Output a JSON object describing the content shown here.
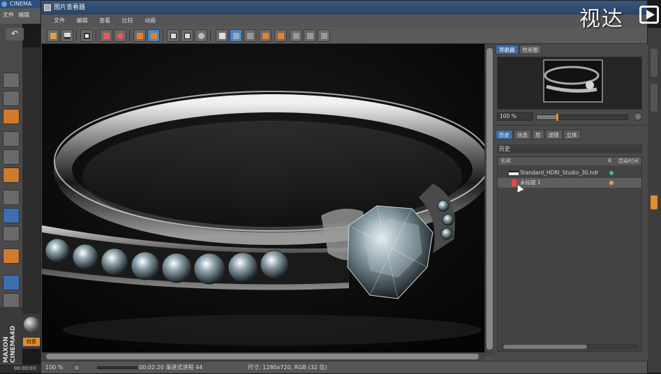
{
  "background_app": {
    "title": "CINEMA",
    "menu": [
      "文件",
      "编辑"
    ],
    "brand_logo": "MAXON CINEMA4D",
    "material_label": "材质",
    "time_readout": "00:00:03"
  },
  "viewer": {
    "title": "图片查看器",
    "menu": [
      "文件",
      "编辑",
      "查看",
      "比较",
      "动画"
    ],
    "toolbar_icons": [
      "open-icon",
      "save-icon",
      "render-icon",
      "render-region-icon",
      "render-queue-icon",
      "copy-icon",
      "paste-icon",
      "filter-icon",
      "compare-a-icon",
      "compare-b-icon",
      "ab-icon",
      "split-icon",
      "label-icon",
      "a-icon",
      "b-icon",
      "stereo-icon",
      "layout-icon",
      "grid-icon"
    ],
    "navigator_tabs": [
      "导航器",
      "柱状图"
    ],
    "nav_zoom": "100 %",
    "history_tabs": [
      "历史",
      "信息",
      "层",
      "滤镜",
      "立体"
    ],
    "history_header": "历史",
    "list_columns": [
      "名称",
      "R",
      "渲染时间"
    ],
    "history_items": [
      {
        "name": "Standard_HDRI_Studio_30.hdr",
        "status_color": "#44c07a"
      },
      {
        "name": "未标题 1",
        "status_color": "#e8a040"
      }
    ],
    "status": {
      "zoom": "100 %",
      "progress": "00:02:20 渐进式进程 44",
      "size_info": "尺寸: 1280x720, RGB (32 位)"
    }
  },
  "watermark": "视达"
}
